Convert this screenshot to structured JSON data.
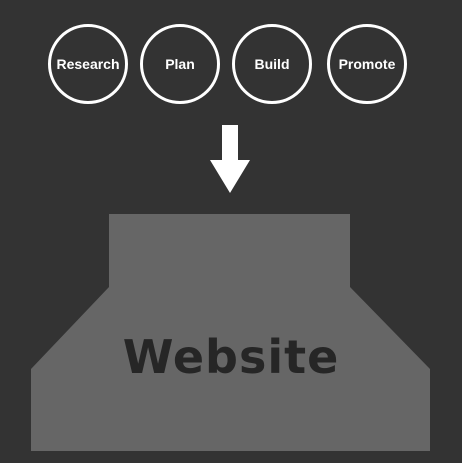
{
  "stages": [
    {
      "label": "Research"
    },
    {
      "label": "Plan"
    },
    {
      "label": "Build"
    },
    {
      "label": "Promote"
    }
  ],
  "target": {
    "label": "Website"
  },
  "colors": {
    "background": "#333333",
    "stage_outline": "#ffffff",
    "arrow": "#ffffff",
    "target_fill": "#666666",
    "target_text": "#262626"
  },
  "icons": {
    "flow_arrow": "arrow-down-icon"
  }
}
